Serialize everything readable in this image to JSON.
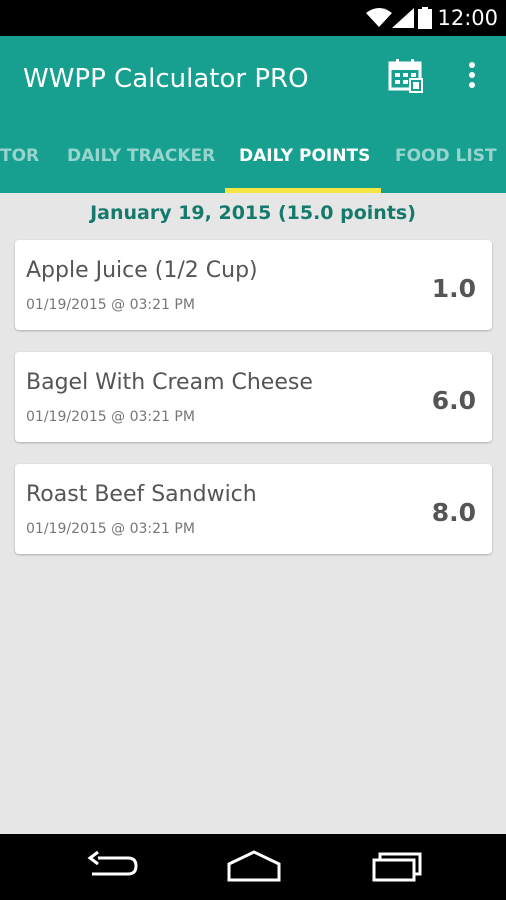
{
  "status_bar": {
    "time": "12:00"
  },
  "app_bar": {
    "title": "WWPP Calculator PRO",
    "calendar_icon": "calendar-icon",
    "overflow_icon": "more-vert-icon"
  },
  "tabs": [
    {
      "label": "TOR",
      "active": false
    },
    {
      "label": "DAILY TRACKER",
      "active": false
    },
    {
      "label": "DAILY POINTS",
      "active": true
    },
    {
      "label": "FOOD LIST",
      "active": false
    }
  ],
  "date_header": "January 19, 2015 (15.0 points)",
  "entries": [
    {
      "name": "Apple Juice (1/2 Cup)",
      "timestamp": "01/19/2015 @ 03:21 PM",
      "points": "1.0"
    },
    {
      "name": "Bagel With Cream Cheese",
      "timestamp": "01/19/2015 @ 03:21 PM",
      "points": "6.0"
    },
    {
      "name": "Roast Beef Sandwich",
      "timestamp": "01/19/2015 @ 03:21 PM",
      "points": "8.0"
    }
  ],
  "colors": {
    "primary": "#17a090",
    "accent": "#f5e642",
    "date_text": "#157a6c",
    "background": "#e6e6e6"
  }
}
